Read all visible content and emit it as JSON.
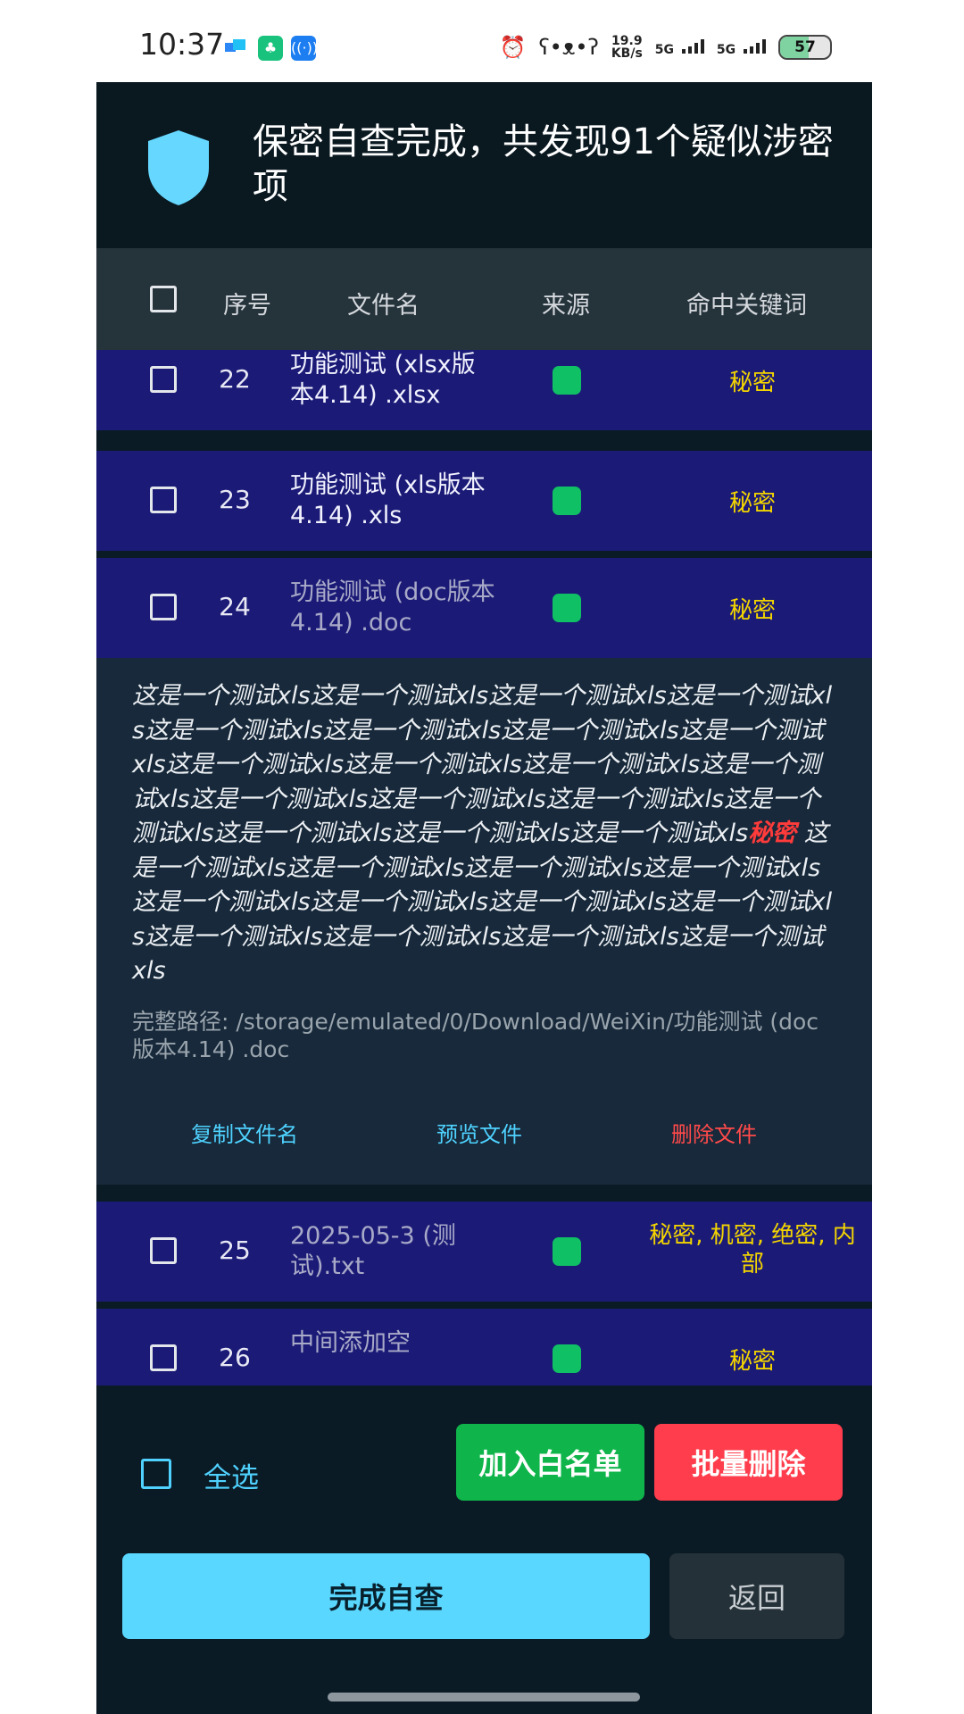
{
  "status_bar": {
    "time": "10:37",
    "speed_value": "19.9",
    "speed_unit": "KB/s",
    "net1": "5G",
    "net2": "5G",
    "battery": "57",
    "icons": [
      "notification-app-icon",
      "chat-app-icon",
      "wireless-app-icon",
      "alarm-icon",
      "bear-icon",
      "signal-icon",
      "battery-icon"
    ]
  },
  "header": {
    "title": "保密自查完成，共发现91个疑似涉密项",
    "icon": "shield-icon",
    "shield_color": "#66d7ff"
  },
  "table": {
    "columns": [
      "序号",
      "文件名",
      "来源",
      "命中关键词"
    ],
    "rows": [
      {
        "num": "22",
        "name": "功能测试 (xlsx版本4.14) .xlsx",
        "keywords": "秘密"
      },
      {
        "num": "23",
        "name": "功能测试 (xls版本4.14) .xls",
        "keywords": "秘密"
      },
      {
        "num": "24",
        "name": "功能测试 (doc版本4.14) .doc",
        "keywords": "秘密"
      },
      {
        "num": "25",
        "name": "2025-05-3 (测试).txt",
        "keywords": "秘密, 机密, 绝密, 内部"
      },
      {
        "num": "26",
        "name": "中间添加空",
        "keywords": "秘密"
      }
    ]
  },
  "detail": {
    "content_before": "这是一个测试xls这是一个测试xls这是一个测试xls这是一个测试xls这是一个测试xls这是一个测试xls这是一个测试xls这是一个测试xls这是一个测试xls这是一个测试xls这是一个测试xls这是一个测试xls这是一个测试xls这是一个测试xls这是一个测试xls这是一个测试xls这是一个测试xls这是一个测试xls这是一个测试xls",
    "highlight": "秘密",
    "content_after": " 这是一个测试xls这是一个测试xls这是一个测试xls这是一个测试xls这是一个测试xls这是一个测试xls这是一个测试xls这是一个测试xls这是一个测试xls这是一个测试xls这是一个测试xls这是一个测试xls",
    "path": "完整路径: /storage/emulated/0/Download/WeiXin/功能测试 (doc版本4.14) .doc",
    "actions": {
      "copy": "复制文件名",
      "preview": "预览文件",
      "delete": "删除文件"
    }
  },
  "bottom": {
    "select_all": "全选",
    "whitelist": "加入白名单",
    "batch_delete": "批量删除",
    "finish": "完成自查",
    "back": "返回"
  },
  "colors": {
    "accent": "#4fd2ff",
    "keyword": "#f3d400",
    "danger": "#ff3d4c",
    "row_bg": "#1b1b77",
    "whitelist_bg": "#0fb54b"
  }
}
